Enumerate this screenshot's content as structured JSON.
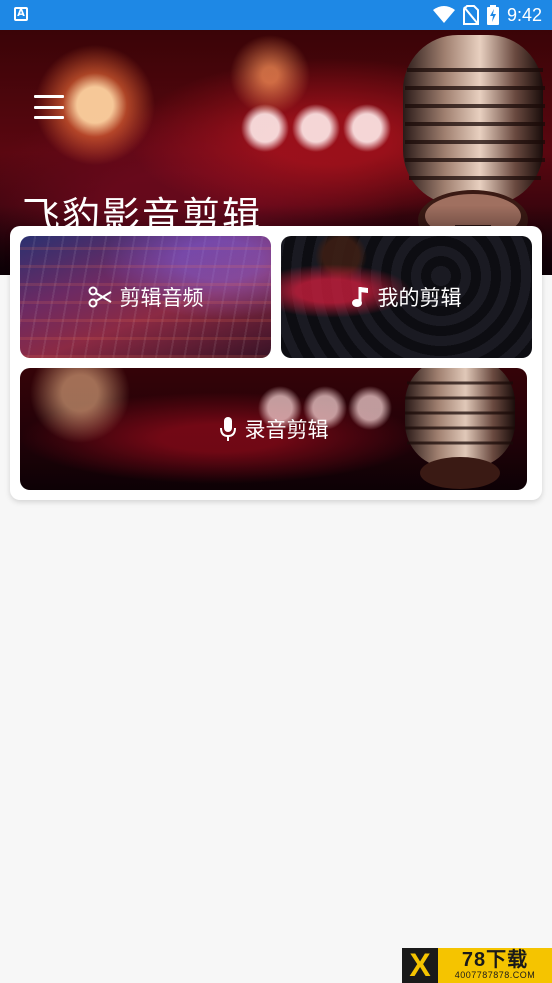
{
  "status_bar": {
    "time": "9:42",
    "app_icon_letter": "A",
    "icons": [
      "wifi-icon",
      "no-sim-icon",
      "battery-charging-icon"
    ],
    "bg_color": "#1e88e5"
  },
  "header": {
    "title": "飞豹影音剪辑",
    "menu_icon": "hamburger-menu-icon"
  },
  "tiles": {
    "cut_audio": {
      "label": "剪辑音频",
      "icon": "scissors-icon"
    },
    "my_edits": {
      "label": "我的剪辑",
      "icon": "music-note-icon"
    },
    "record_edit": {
      "label": "录音剪辑",
      "icon": "microphone-icon"
    }
  },
  "watermark": {
    "letter": "X",
    "main": "78下载",
    "sub": "4007787878.COM",
    "color": "#f5c400"
  }
}
